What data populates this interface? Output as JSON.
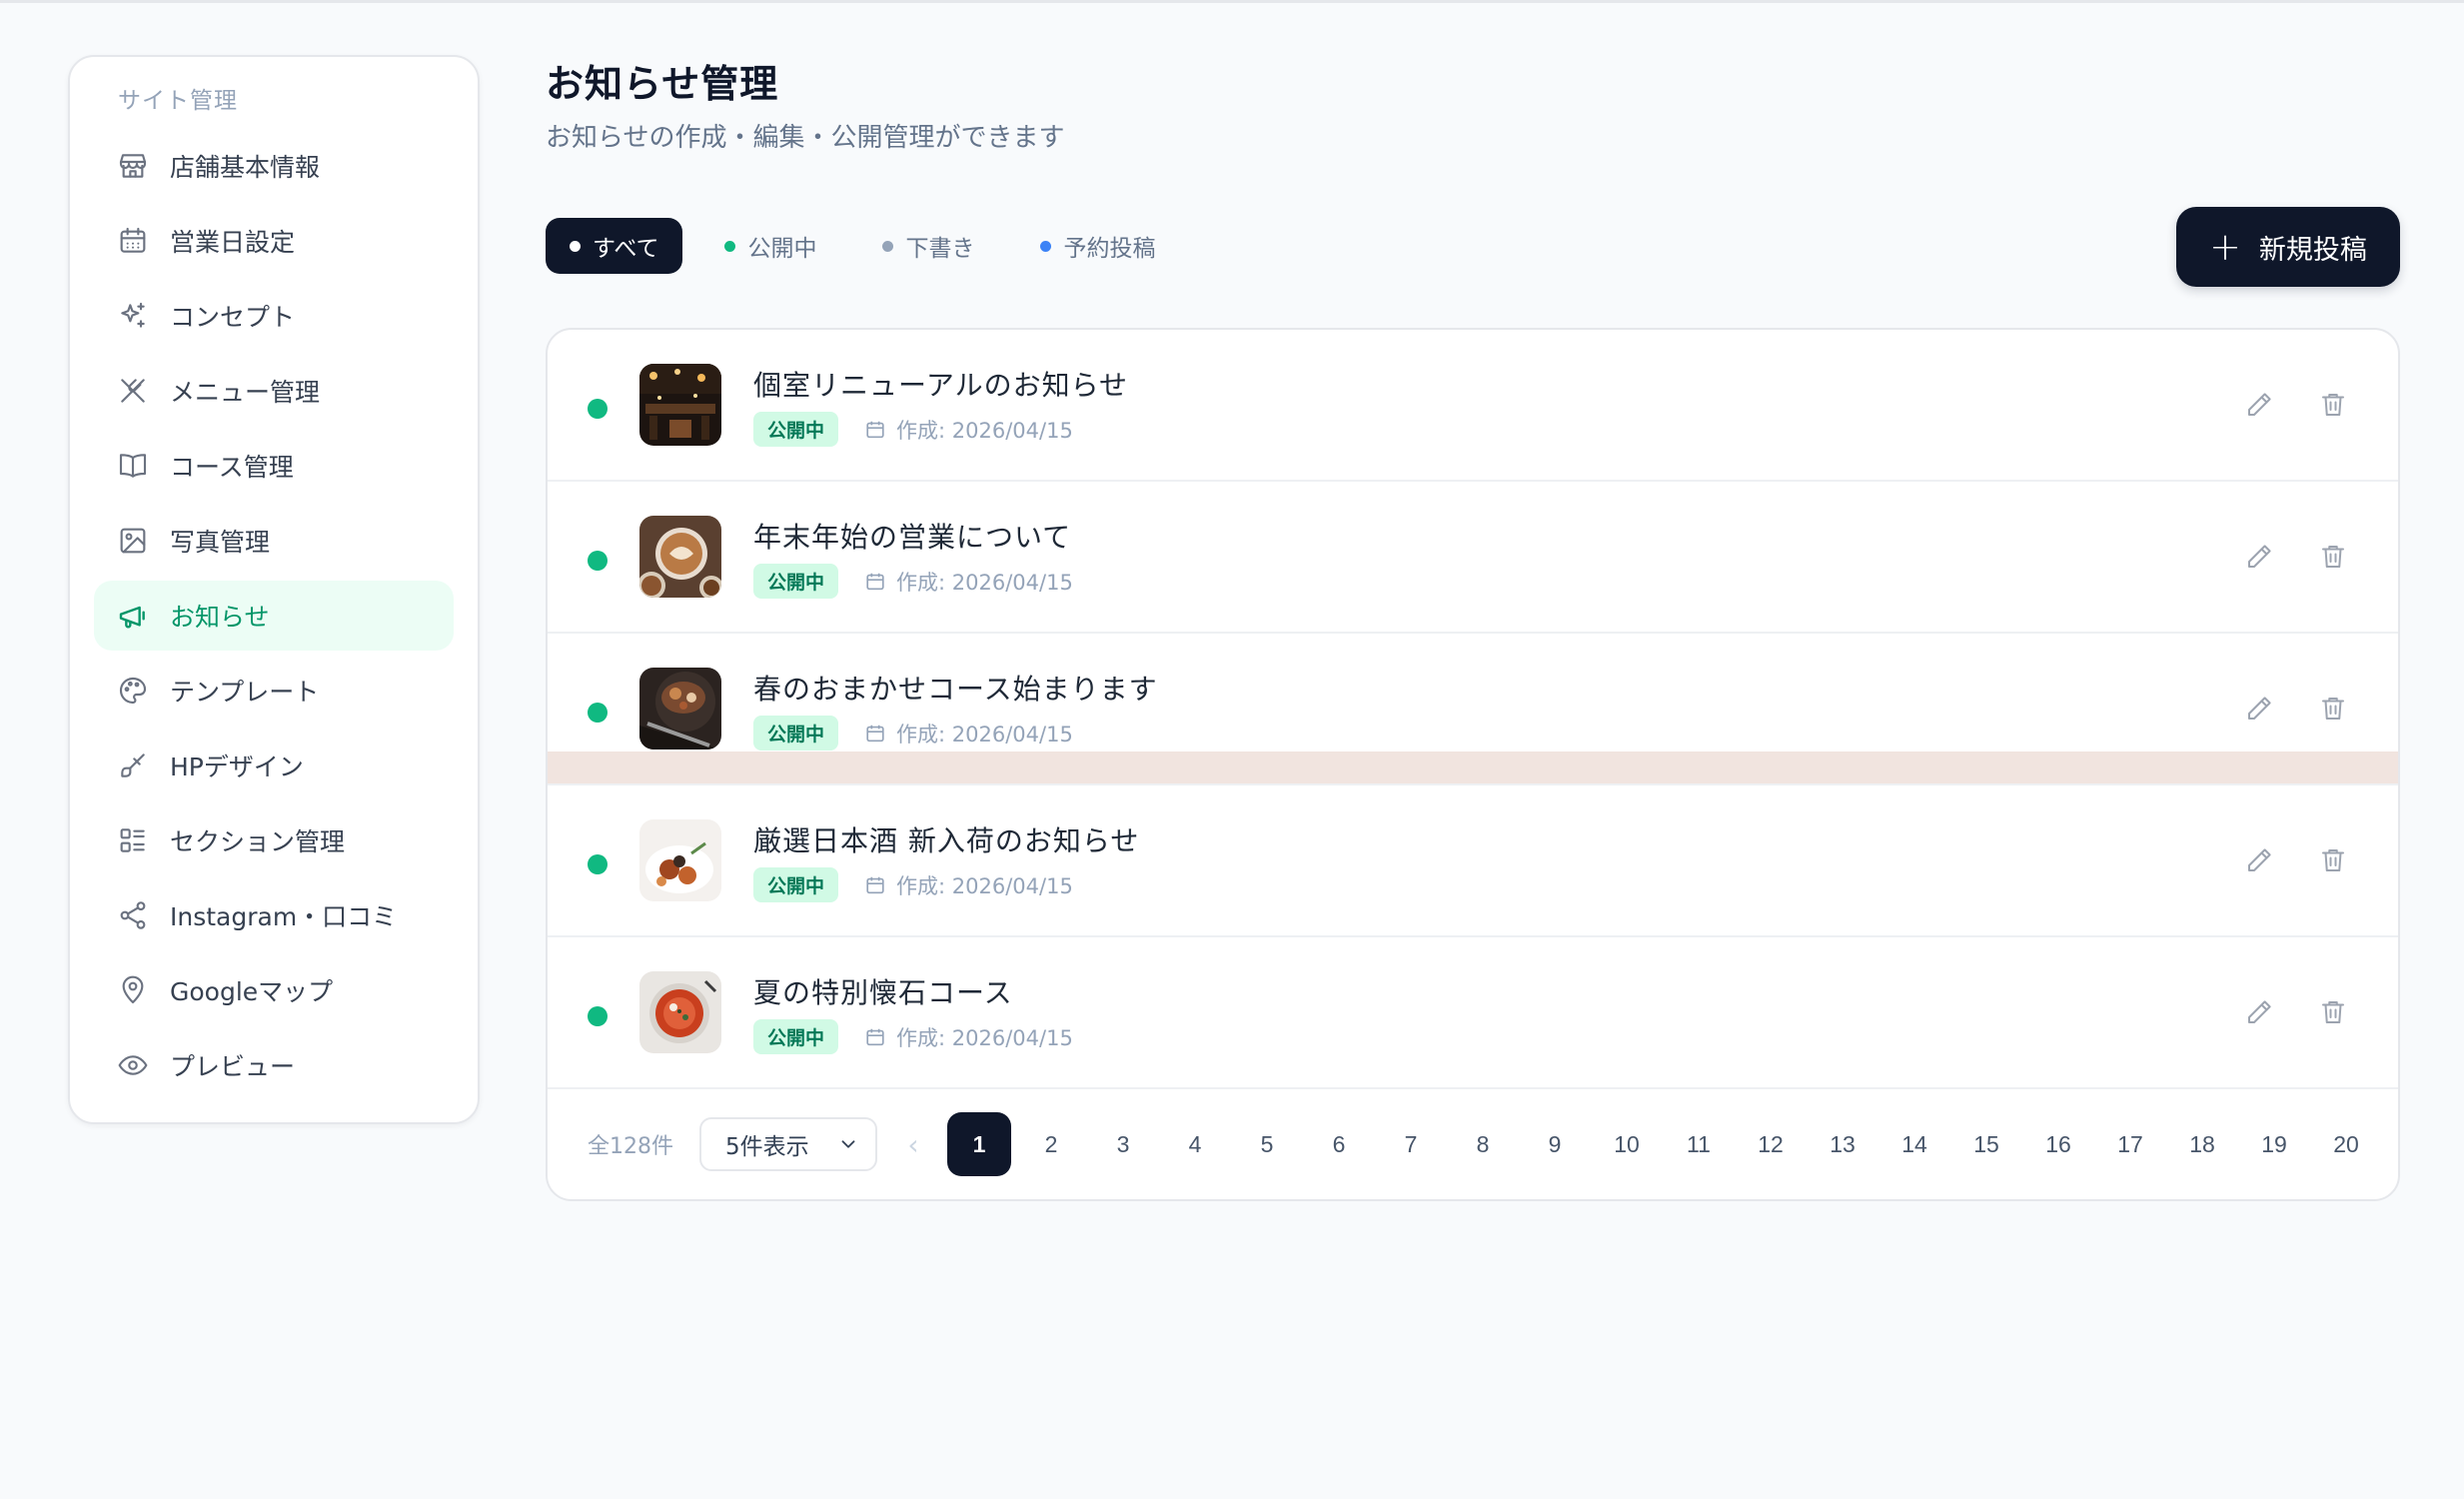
{
  "sidebar": {
    "heading": "サイト管理",
    "items": [
      {
        "label": "店舗基本情報",
        "icon": "store-icon"
      },
      {
        "label": "営業日設定",
        "icon": "calendar-icon"
      },
      {
        "label": "コンセプト",
        "icon": "sparkles-icon"
      },
      {
        "label": "メニュー管理",
        "icon": "utensils-icon"
      },
      {
        "label": "コース管理",
        "icon": "book-open-icon"
      },
      {
        "label": "写真管理",
        "icon": "image-icon"
      },
      {
        "label": "お知らせ",
        "icon": "megaphone-icon",
        "active": true
      },
      {
        "label": "テンプレート",
        "icon": "palette-icon"
      },
      {
        "label": "HPデザイン",
        "icon": "brush-icon"
      },
      {
        "label": "セクション管理",
        "icon": "layout-list-icon"
      },
      {
        "label": "Instagram・口コミ",
        "icon": "share-icon"
      },
      {
        "label": "Googleマップ",
        "icon": "map-pin-icon"
      },
      {
        "label": "プレビュー",
        "icon": "eye-icon"
      }
    ]
  },
  "header": {
    "title": "お知らせ管理",
    "subtitle": "お知らせの作成・編集・公開管理ができます"
  },
  "filters": [
    {
      "label": "すべて",
      "dot_color": "#ffffff",
      "active": true
    },
    {
      "label": "公開中",
      "dot_color": "#10b981"
    },
    {
      "label": "下書き",
      "dot_color": "#94a3b8"
    },
    {
      "label": "予約投稿",
      "dot_color": "#3b82f6"
    }
  ],
  "new_post_button": {
    "label": "新規投稿"
  },
  "posts": [
    {
      "title": "個室リニューアルのお知らせ",
      "status": "公開中",
      "created": "作成: 2026/04/15",
      "thumb": "restaurant-interior"
    },
    {
      "title": "年末年始の営業について",
      "status": "公開中",
      "created": "作成: 2026/04/15",
      "thumb": "coffee-latte"
    },
    {
      "title": "春のおまかせコース始まります",
      "status": "公開中",
      "created": "作成: 2026/04/15",
      "thumb": "grilled-dish"
    },
    {
      "title": "厳選日本酒 新入荷のお知らせ",
      "status": "公開中",
      "created": "作成: 2026/04/15",
      "thumb": "plated-food"
    },
    {
      "title": "夏の特別懐石コース",
      "status": "公開中",
      "created": "作成: 2026/04/15",
      "thumb": "soup-bowl"
    }
  ],
  "pagination": {
    "total": "全128件",
    "per_page": "5件表示",
    "current": "1",
    "pages": [
      "1",
      "2",
      "3",
      "4",
      "5",
      "6",
      "7",
      "8",
      "9",
      "10",
      "11",
      "12",
      "13",
      "14",
      "15",
      "16",
      "17",
      "18",
      "19",
      "20"
    ]
  },
  "colors": {
    "accent_dark": "#0f172a",
    "published_green": "#10b981",
    "active_nav_bg": "#ecfdf5"
  }
}
